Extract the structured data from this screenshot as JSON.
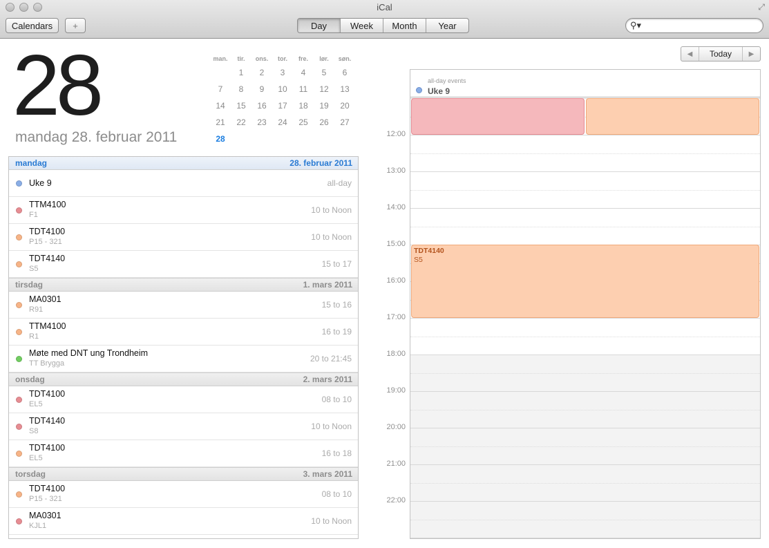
{
  "window": {
    "title": "iCal"
  },
  "toolbar": {
    "calendars_label": "Calendars",
    "add_label": "+",
    "views": [
      "Day",
      "Week",
      "Month",
      "Year"
    ],
    "active_view": "Day",
    "search": {
      "value": "",
      "placeholder": ""
    }
  },
  "selected_date": {
    "day_number": "28",
    "label": "mandag 28. februar 2011"
  },
  "mini_calendar": {
    "weekdays": [
      "man.",
      "tir.",
      "ons.",
      "tor.",
      "fre.",
      "lør.",
      "søn."
    ],
    "weeks": [
      [
        "",
        "1",
        "2",
        "3",
        "4",
        "5",
        "6"
      ],
      [
        "7",
        "8",
        "9",
        "10",
        "11",
        "12",
        "13"
      ],
      [
        "14",
        "15",
        "16",
        "17",
        "18",
        "19",
        "20"
      ],
      [
        "21",
        "22",
        "23",
        "24",
        "25",
        "26",
        "27"
      ],
      [
        "28",
        "",
        "",
        "",
        "",
        "",
        ""
      ]
    ],
    "today": "28"
  },
  "colors": {
    "red": "#e78d93",
    "orange": "#f7b487",
    "green": "#72cd62",
    "blue": "#8aaee6",
    "block_red": "#f5b8bc",
    "block_orange": "#fdcfb0"
  },
  "list": {
    "days": [
      {
        "name": "mandag",
        "date": "28. februar 2011",
        "current": true,
        "events": [
          {
            "title": "Uke 9",
            "location": "",
            "time": "all-day",
            "color": "blue"
          },
          {
            "title": "TTM4100",
            "location": "F1",
            "time": "10 to Noon",
            "color": "red"
          },
          {
            "title": "TDT4100",
            "location": "P15 - 321",
            "time": "10 to Noon",
            "color": "orange"
          },
          {
            "title": "TDT4140",
            "location": "S5",
            "time": "15 to 17",
            "color": "orange"
          }
        ]
      },
      {
        "name": "tirsdag",
        "date": "1. mars 2011",
        "current": false,
        "events": [
          {
            "title": "MA0301",
            "location": "R91",
            "time": "15 to 16",
            "color": "orange"
          },
          {
            "title": "TTM4100",
            "location": "R1",
            "time": "16 to 19",
            "color": "orange"
          },
          {
            "title": "Møte med DNT ung Trondheim",
            "location": "TT Brygga",
            "time": "20 to 21:45",
            "color": "green"
          }
        ]
      },
      {
        "name": "onsdag",
        "date": "2. mars 2011",
        "current": false,
        "events": [
          {
            "title": "TDT4100",
            "location": "EL5",
            "time": "08 to 10",
            "color": "red"
          },
          {
            "title": "TDT4140",
            "location": "S8",
            "time": "10 to Noon",
            "color": "red"
          },
          {
            "title": "TDT4100",
            "location": "EL5",
            "time": "16 to 18",
            "color": "orange"
          }
        ]
      },
      {
        "name": "torsdag",
        "date": "3. mars 2011",
        "current": false,
        "events": [
          {
            "title": "TDT4100",
            "location": "P15 - 321",
            "time": "08 to 10",
            "color": "orange"
          },
          {
            "title": "MA0301",
            "location": "KJL1",
            "time": "10 to Noon",
            "color": "red"
          }
        ]
      }
    ]
  },
  "day_view": {
    "nav": {
      "today_label": "Today"
    },
    "allday": {
      "label": "all-day events",
      "title": "Uke 9"
    },
    "hour_labels": [
      "12:00",
      "13:00",
      "14:00",
      "15:00",
      "16:00",
      "17:00",
      "18:00",
      "19:00",
      "20:00",
      "21:00",
      "22:00"
    ],
    "blocks": [
      {
        "title": "",
        "location": "",
        "color": "block_red",
        "start": 11,
        "end": 12,
        "col": 0,
        "cols": 2
      },
      {
        "title": "",
        "location": "",
        "color": "block_orange",
        "start": 11,
        "end": 12,
        "col": 1,
        "cols": 2
      },
      {
        "title": "TDT4140",
        "location": "S5",
        "color": "block_orange",
        "start": 15,
        "end": 17,
        "col": 0,
        "cols": 1
      }
    ]
  }
}
